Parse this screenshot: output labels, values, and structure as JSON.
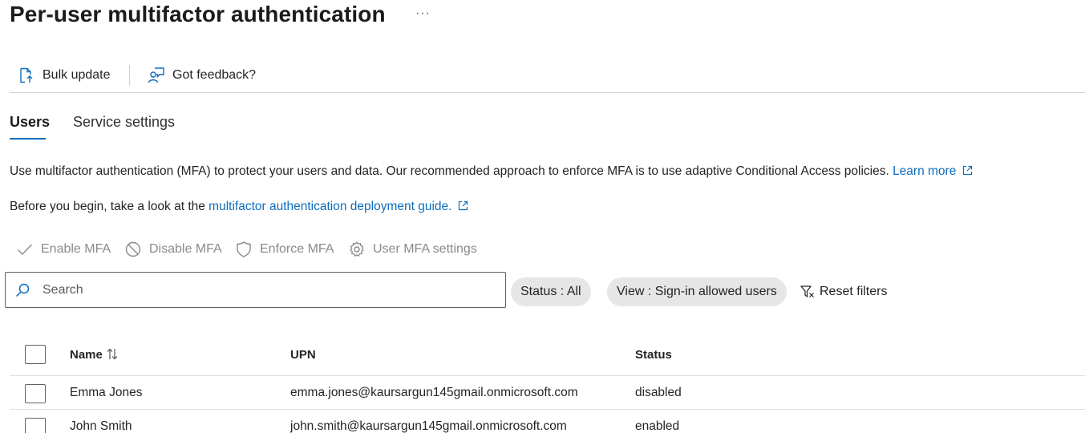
{
  "header": {
    "title": "Per-user multifactor authentication",
    "more_label": "···"
  },
  "toolbar": {
    "bulk_update": "Bulk update",
    "feedback": "Got feedback?"
  },
  "tabs": [
    {
      "label": "Users",
      "active": true
    },
    {
      "label": "Service settings",
      "active": false
    }
  ],
  "description": {
    "line1": "Use multifactor authentication (MFA) to protect your users and data. Our recommended approach to enforce MFA is to use adaptive Conditional Access policies. ",
    "line1_link": "Learn more",
    "line2": "Before you begin, take a look at the ",
    "line2_link": "multifactor authentication deployment guide."
  },
  "actions": {
    "enable": "Enable MFA",
    "disable": "Disable MFA",
    "enforce": "Enforce MFA",
    "settings": "User MFA settings"
  },
  "search": {
    "placeholder": "Search",
    "value": ""
  },
  "filters": {
    "status": "Status : All",
    "view": "View : Sign-in allowed users",
    "reset": "Reset filters"
  },
  "table": {
    "columns": [
      "Name",
      "UPN",
      "Status"
    ],
    "rows": [
      {
        "name": "Emma Jones",
        "upn": "emma.jones@kaursargun145gmail.onmicrosoft.com",
        "status": "disabled"
      },
      {
        "name": "John Smith",
        "upn": "john.smith@kaursargun145gmail.onmicrosoft.com",
        "status": "enabled"
      }
    ]
  },
  "colors": {
    "accent": "#0f6cbd",
    "disabled_text": "#8a8a8a",
    "pill_bg": "#e6e6e6"
  }
}
